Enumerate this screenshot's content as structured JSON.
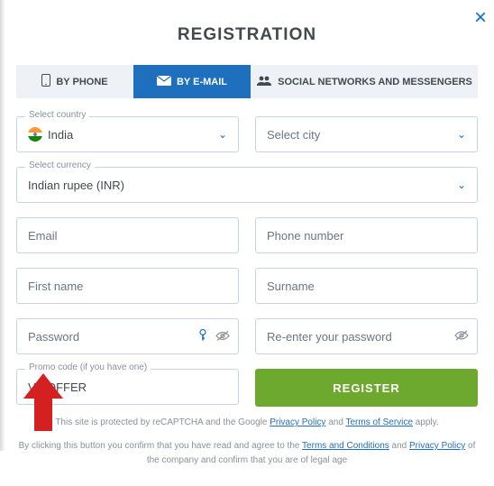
{
  "header": {
    "title": "REGISTRATION"
  },
  "tabs": {
    "phone": "BY PHONE",
    "email": "BY E-MAIL",
    "social": "SOCIAL NETWORKS AND MESSENGERS"
  },
  "fields": {
    "country": {
      "legend": "Select country",
      "value": "India"
    },
    "city": {
      "placeholder": "Select city"
    },
    "currency": {
      "legend": "Select currency",
      "value": "Indian rupee (INR)"
    },
    "email": {
      "placeholder": "Email"
    },
    "phone": {
      "placeholder": "Phone number"
    },
    "firstname": {
      "placeholder": "First name"
    },
    "surname": {
      "placeholder": "Surname"
    },
    "password": {
      "placeholder": "Password"
    },
    "repassword": {
      "placeholder": "Re-enter your password"
    },
    "promo": {
      "legend": "Promo code (if you have one)",
      "value": "VIPOFFER"
    }
  },
  "actions": {
    "register": "REGISTER"
  },
  "fineprint": {
    "recaptcha_pre": "This site is protected by reCAPTCHA and the Google ",
    "privacy": "Privacy Policy",
    "and": " and ",
    "tos": "Terms of Service",
    "apply": " apply.",
    "line2_pre": "By clicking this button you confirm that you have read and agree to the ",
    "terms": "Terms and Conditions",
    "line2_and": " and ",
    "privacy2": "Privacy Policy",
    "line2_post": " of the company and confirm that you are of legal age"
  }
}
